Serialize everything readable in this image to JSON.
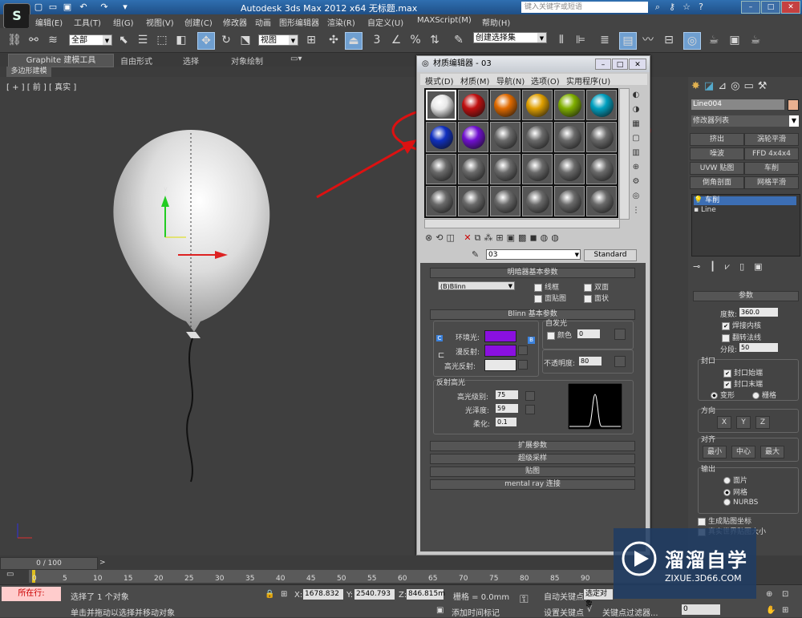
{
  "window": {
    "title": "Autodesk 3ds Max  2012 x64      无标题.max",
    "search_placeholder": "键入关键字或短语",
    "app_logo": "S"
  },
  "menu": [
    "编辑(E)",
    "工具(T)",
    "组(G)",
    "视图(V)",
    "创建(C)",
    "修改器",
    "动画",
    "图形编辑器",
    "渲染(R)",
    "自定义(U)",
    "MAXScript(M)",
    "帮助(H)"
  ],
  "toolbar": {
    "selection_filter": "全部",
    "ref_coord": "视图",
    "named_selection": "创建选择集",
    "snap_3": "3",
    "snap_percent": "%"
  },
  "ribbon": {
    "tabs": [
      "Graphite 建模工具",
      "自由形式",
      "选择",
      "对象绘制"
    ],
    "subtab": "多边形建模"
  },
  "viewport": {
    "label": "[ + ] [ 前 ] [ 真实 ]",
    "gizmo_y": "y",
    "gizmo_x": "x"
  },
  "material_editor": {
    "title": "材质编辑器 - 03",
    "menu": [
      "模式(D)",
      "材质(M)",
      "导航(N)",
      "选项(O)",
      "实用程序(U)"
    ],
    "slot_colors": [
      [
        "#e8e8e8",
        "#c01010",
        "#e06a00",
        "#e0a000",
        "#80b000",
        "#00a0c0"
      ],
      [
        "#1030c0",
        "#7010d0",
        "#6a6a6a",
        "#6a6a6a",
        "#6a6a6a",
        "#6a6a6a"
      ],
      [
        "#6a6a6a",
        "#6a6a6a",
        "#6a6a6a",
        "#6a6a6a",
        "#6a6a6a",
        "#6a6a6a"
      ],
      [
        "#6a6a6a",
        "#6a6a6a",
        "#6a6a6a",
        "#6a6a6a",
        "#6a6a6a",
        "#6a6a6a"
      ]
    ],
    "material_name": "03",
    "material_type": "Standard",
    "shader_rollout": "明暗器基本参数",
    "shader": "(B)Blinn",
    "wire": "线框",
    "two_sided": "双面",
    "face_map": "面贴图",
    "faceted": "面状",
    "blinn_rollout": "Blinn 基本参数",
    "self_illum": "自发光",
    "color_label": "颜色",
    "color_value": "0",
    "ambient": "环境光:",
    "diffuse": "漫反射:",
    "specular": "高光反射:",
    "opacity_label": "不透明度:",
    "opacity_value": "80",
    "spec_highlights": "反射高光",
    "spec_level_label": "高光级别:",
    "spec_level": "75",
    "gloss_label": "光泽度:",
    "gloss": "59",
    "soften_label": "柔化:",
    "soften": "0.1",
    "ambient_color": "#8a10e0",
    "diffuse_color": "#8a10e0",
    "specular_color": "#e8e8e8",
    "rollouts": [
      "扩展参数",
      "超级采样",
      "贴图",
      "mental ray 连接"
    ],
    "c_label": "C",
    "lock_label": "B"
  },
  "command_panel": {
    "object_name": "Line004",
    "modifier_list": "修改器列表",
    "buttons": [
      "挤出",
      "涡轮平滑",
      "噪波",
      "FFD 4x4x4",
      "UVW 贴图",
      "车削",
      "倒角剖面",
      "网格平滑"
    ],
    "stack": [
      "车削",
      "Line"
    ],
    "params_title": "参数",
    "degrees_label": "度数:",
    "degrees": "360.0",
    "weld_core": "焊接内核",
    "flip_normals": "翻转法线",
    "segments_label": "分段:",
    "segments": "50",
    "capping": "封口",
    "cap_start": "封口始端",
    "cap_end": "封口末端",
    "morph": "变形",
    "grid": "栅格",
    "direction": "方向",
    "dir_x": "X",
    "dir_y": "Y",
    "dir_z": "Z",
    "align": "对齐",
    "align_min": "最小",
    "align_center": "中心",
    "align_max": "最大",
    "output": "输出",
    "out_patch": "面片",
    "out_mesh": "网格",
    "out_nurbs": "NURBS",
    "gen_map": "生成贴图坐标",
    "real_world": "真实世界贴图大小"
  },
  "timeline": {
    "frame": "0 / 100",
    "ticks": [
      "0",
      "5",
      "10",
      "15",
      "20",
      "25",
      "30",
      "35",
      "40",
      "45",
      "50",
      "55",
      "60",
      "65",
      "70",
      "75",
      "80",
      "85",
      "90"
    ]
  },
  "status": {
    "in_progress": "所在行:",
    "selected": "选择了 1 个对象",
    "prompt": "单击并拖动以选择并移动对象",
    "x_label": "X:",
    "x": "1678.832",
    "y_label": "Y:",
    "y": "2540.793",
    "z_label": "Z:",
    "z": "846.815m",
    "grid": "栅格 = 0.0mm",
    "add_time_tag": "添加时间标记",
    "auto_key": "自动关键点",
    "set_key": "设置关键点",
    "selected_obj": "选定对象",
    "key_filters": "关键点过滤器...",
    "frame_field": "0"
  },
  "watermark": {
    "brand": "溜溜自学",
    "url": "ZIXUE.3D66.COM"
  }
}
